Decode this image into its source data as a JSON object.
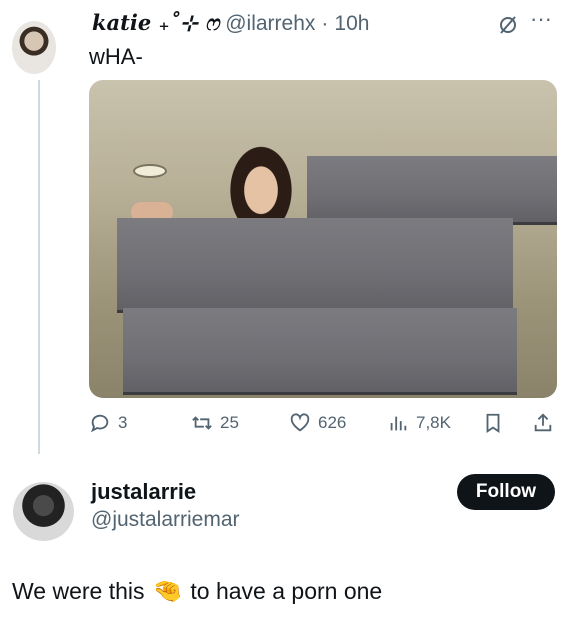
{
  "tweet": {
    "display_name": "katie ₊˚⊹ ෆ",
    "handle": "@ilarrehx",
    "separator": "·",
    "time": "10h",
    "text": "wHA-"
  },
  "actions": {
    "replies": "3",
    "retweets": "25",
    "likes": "626",
    "views": "7,8K"
  },
  "suggested": {
    "name": "justalarrie",
    "handle": "@justalarriemar",
    "follow_label": "Follow"
  },
  "caption": {
    "before": "We were this",
    "emoji": "🤏",
    "after": "to have a porn one"
  },
  "icons": [
    "grok-icon",
    "more-icon",
    "reply-icon",
    "retweet-icon",
    "like-icon",
    "views-icon",
    "bookmark-icon",
    "share-icon",
    "pinch-emoji"
  ]
}
